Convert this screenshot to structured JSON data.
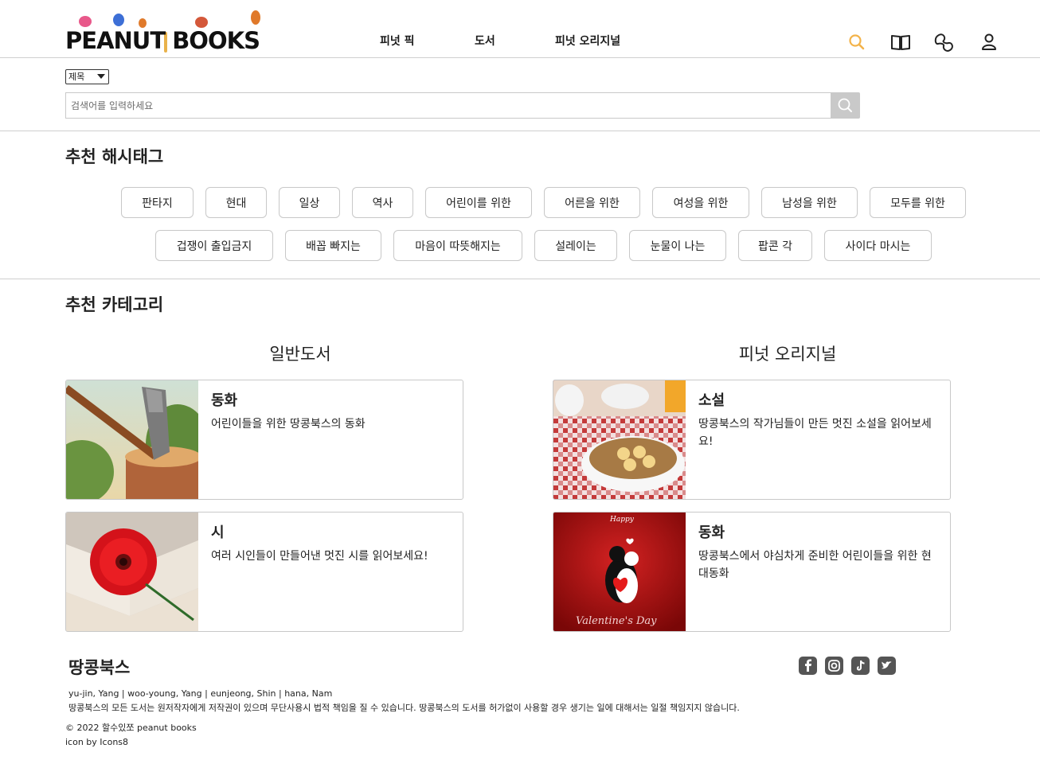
{
  "header": {
    "logo": "PEANUT BOOKS",
    "nav": [
      "피넛 픽",
      "도서",
      "피넛 오리지널"
    ]
  },
  "search": {
    "select_value": "제목",
    "placeholder": "검색어를 입력하세요"
  },
  "hashtags": {
    "title": "추천 해시태그",
    "row1": [
      "판타지",
      "현대",
      "일상",
      "역사",
      "어린이를 위한",
      "어른을 위한",
      "여성을 위한",
      "남성을 위한",
      "모두를 위한"
    ],
    "row2": [
      "겁쟁이 출입금지",
      "배꼽 빠지는",
      "마음이 따뜻해지는",
      "설레이는",
      "눈물이 나는",
      "팝콘 각",
      "사이다 마시는"
    ]
  },
  "categories": {
    "title": "추천 카테고리",
    "general": {
      "title": "일반도서",
      "cards": [
        {
          "title": "동화",
          "desc": "어린이들을 위한 땅콩북스의 동화"
        },
        {
          "title": "시",
          "desc": "여러 시인들이 만들어낸 멋진 시를 읽어보세요!"
        }
      ]
    },
    "original": {
      "title": "피넛 오리지널",
      "cards": [
        {
          "title": "소설",
          "desc": "땅콩북스의 작가님들이 만든 멋진 소설을 읽어보세요!"
        },
        {
          "title": "동화",
          "desc": "땅콩북스에서 야심차게 준비한 어린이들을 위한 현대동화"
        }
      ]
    }
  },
  "card_images": {
    "happy_text": "Happy",
    "valentine_text": "Valentine's Day"
  },
  "footer": {
    "title": "땅콩북스",
    "authors": "yu-jin, Yang  |  woo-young, Yang  |  eunjeong, Shin  |  hana, Nam",
    "notice": "땅콩북스의 모든 도서는 원저작자에게 저작권이 있으며 무단사용시 법적 책임을 질 수 있습니다. 땅콩북스의 도서를 허가없이 사용할 경우 생기는 일에 대해서는 일절 책임지지 않습니다.",
    "copyright": "© 2022 할수있쪼 peanut books",
    "icon_credit": "icon by Icons8"
  },
  "icons": {
    "header": [
      "search-icon",
      "book-icon",
      "peanut-icon",
      "user-icon"
    ],
    "social": [
      "facebook-icon",
      "instagram-icon",
      "tiktok-icon",
      "twitter-icon"
    ]
  },
  "colors": {
    "search_accent": "#f3b34a",
    "border": "#c8c8c8",
    "search_button": "#c9c9c9"
  }
}
